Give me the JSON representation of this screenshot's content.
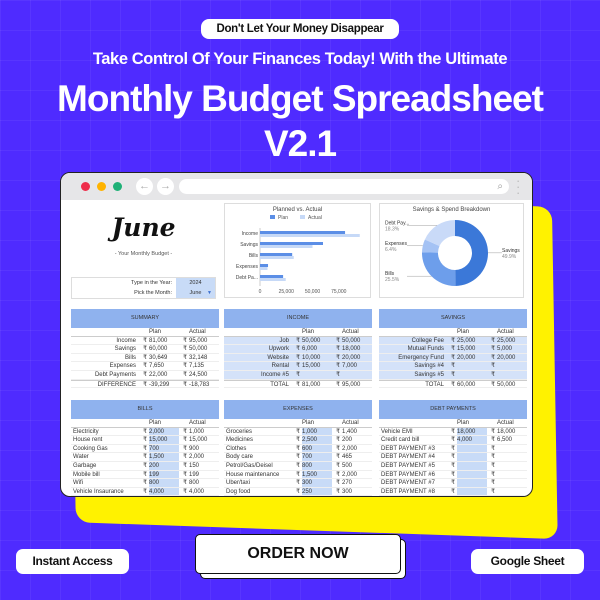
{
  "hero": {
    "tagline": "Don't Let Your Money Disappear",
    "subtitle": "Take Control Of Your Finances Today! With the Ultimate",
    "title_line1": "Monthly Budget Spreadsheet",
    "title_line2": "V2.1"
  },
  "browser": {
    "back_icon": "←",
    "forward_icon": "→",
    "search_icon": "⌕",
    "menu_icon": "⋮"
  },
  "sheet": {
    "month": "June",
    "month_subtitle": "- Your Monthly Budget -",
    "year_label": "Type in the Year:",
    "year_value": "2024",
    "month_label": "Pick the Month:",
    "month_value": "June",
    "currency": "₹",
    "plan_header": "Plan",
    "actual_header": "Actual"
  },
  "chart_data": [
    {
      "type": "bar",
      "orientation": "horizontal",
      "title": "Planned vs. Actual",
      "categories": [
        "Income",
        "Savings",
        "Bills",
        "Expenses",
        "Debt Pa..."
      ],
      "series": [
        {
          "name": "Plan",
          "values": [
            81000,
            60000,
            30649,
            7650,
            22000
          ],
          "color": "#5b8ee6"
        },
        {
          "name": "Actual",
          "values": [
            95000,
            50000,
            32148,
            7135,
            24500
          ],
          "color": "#c6d9f7"
        }
      ],
      "xticks": [
        "0",
        "25,000",
        "50,000",
        "75,000"
      ],
      "xlim": [
        0,
        100000
      ],
      "legend": "top"
    },
    {
      "type": "pie",
      "style": "donut",
      "title": "Savings & Spend Breakdown",
      "slices": [
        {
          "label": "Savings",
          "value": 49.9,
          "display": "49.9%",
          "color": "#3b78d8"
        },
        {
          "label": "Bills",
          "value": 25.5,
          "display": "25.5%",
          "color": "#6d9eeb"
        },
        {
          "label": "Expenses",
          "value": 6.4,
          "display": "6.4%",
          "color": "#a4c2f4"
        },
        {
          "label": "Debt Pay...",
          "value": 18.3,
          "display": "18.3%",
          "color": "#c9daf8"
        }
      ]
    }
  ],
  "summary": {
    "title": "SUMMARY",
    "rows": [
      {
        "label": "Income",
        "plan": "81,000",
        "actual": "95,000"
      },
      {
        "label": "Savings",
        "plan": "60,000",
        "actual": "50,000"
      },
      {
        "label": "Bills",
        "plan": "30,649",
        "actual": "32,148"
      },
      {
        "label": "Expenses",
        "plan": "7,650",
        "actual": "7,135"
      },
      {
        "label": "Debt Payments",
        "plan": "22,000",
        "actual": "24,500"
      }
    ],
    "total": {
      "label": "DIFFERENCE",
      "plan": "-39,299",
      "actual": "-18,783"
    }
  },
  "income": {
    "title": "INCOME",
    "rows": [
      {
        "label": "Job",
        "plan": "50,000",
        "actual": "50,000"
      },
      {
        "label": "Upwork",
        "plan": "6,000",
        "actual": "18,000"
      },
      {
        "label": "Website",
        "plan": "10,000",
        "actual": "20,000"
      },
      {
        "label": "Rental",
        "plan": "15,000",
        "actual": "7,000"
      },
      {
        "label": "Income #5",
        "plan": "",
        "actual": ""
      }
    ],
    "total": {
      "label": "TOTAL",
      "plan": "81,000",
      "actual": "95,000"
    }
  },
  "savings": {
    "title": "SAVINGS",
    "rows": [
      {
        "label": "College Fee",
        "plan": "25,000",
        "actual": "25,000"
      },
      {
        "label": "Mutual Funds",
        "plan": "15,000",
        "actual": "5,000"
      },
      {
        "label": "Emergency Fund",
        "plan": "20,000",
        "actual": "20,000"
      },
      {
        "label": "Savings #4",
        "plan": "",
        "actual": ""
      },
      {
        "label": "Savings #5",
        "plan": "",
        "actual": ""
      }
    ],
    "total": {
      "label": "TOTAL",
      "plan": "60,000",
      "actual": "50,000"
    }
  },
  "bills": {
    "title": "BILLS",
    "rows": [
      {
        "label": "Electricity",
        "plan": "2,000",
        "actual": "1,000"
      },
      {
        "label": "House rent",
        "plan": "15,000",
        "actual": "15,000"
      },
      {
        "label": "Cooking Gas",
        "plan": "700",
        "actual": "900"
      },
      {
        "label": "Water",
        "plan": "1,500",
        "actual": "2,000"
      },
      {
        "label": "Garbage",
        "plan": "200",
        "actual": "150"
      },
      {
        "label": "Mobile bill",
        "plan": "199",
        "actual": "199"
      },
      {
        "label": "Wifi",
        "plan": "800",
        "actual": "800"
      },
      {
        "label": "Vehicle Insaurance",
        "plan": "4,000",
        "actual": "4,000"
      }
    ]
  },
  "expenses": {
    "title": "EXPENSES",
    "rows": [
      {
        "label": "Groceries",
        "plan": "1,000",
        "actual": "1,400"
      },
      {
        "label": "Medicines",
        "plan": "2,500",
        "actual": "200"
      },
      {
        "label": "Clothes",
        "plan": "600",
        "actual": "2,000"
      },
      {
        "label": "Body care",
        "plan": "700",
        "actual": "465"
      },
      {
        "label": "Petrol/Gas/Deisel",
        "plan": "800",
        "actual": "500"
      },
      {
        "label": "House maintenance",
        "plan": "1,500",
        "actual": "2,000"
      },
      {
        "label": "Uber/taxi",
        "plan": "300",
        "actual": "270"
      },
      {
        "label": "Dog food",
        "plan": "250",
        "actual": "300"
      }
    ]
  },
  "debt": {
    "title": "DEBT PAYMENTS",
    "rows": [
      {
        "label": "Vehicle EMI",
        "plan": "18,000",
        "actual": "18,000"
      },
      {
        "label": "Credit card bill",
        "plan": "4,000",
        "actual": "6,500"
      },
      {
        "label": "DEBT PAYMENT #3",
        "plan": "",
        "actual": ""
      },
      {
        "label": "DEBT PAYMENT #4",
        "plan": "",
        "actual": ""
      },
      {
        "label": "DEBT PAYMENT #5",
        "plan": "",
        "actual": ""
      },
      {
        "label": "DEBT PAYMENT #6",
        "plan": "",
        "actual": ""
      },
      {
        "label": "DEBT PAYMENT #7",
        "plan": "",
        "actual": ""
      },
      {
        "label": "DEBT PAYMENT #8",
        "plan": "",
        "actual": ""
      }
    ]
  },
  "cta": {
    "instant_access": "Instant Access",
    "order_now": "ORDER NOW",
    "google_sheet": "Google Sheet"
  }
}
